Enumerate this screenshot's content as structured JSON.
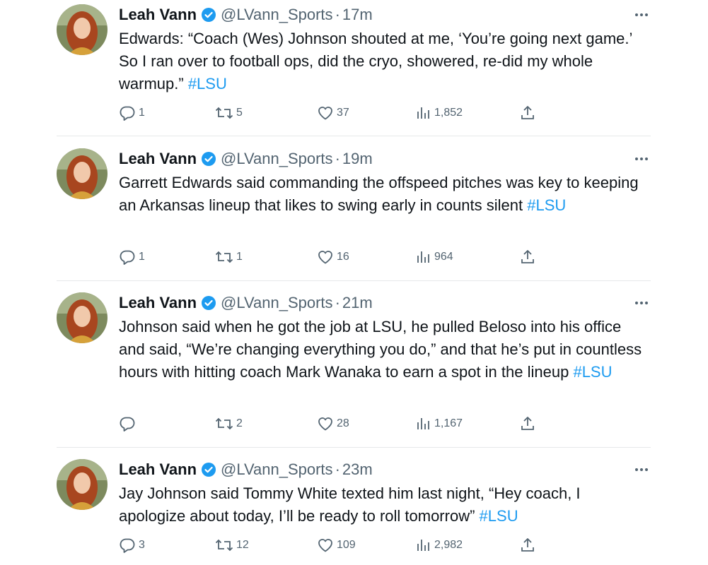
{
  "colors": {
    "text": "#0f1419",
    "secondary": "#536471",
    "link": "#1d9bf0",
    "verified": "#1d9bf0",
    "divider": "#e6e8ea"
  },
  "tweets": [
    {
      "name": "Leah Vann",
      "handle": "@LVann_Sports",
      "separator": "·",
      "time": "17m",
      "text": "Edwards: “Coach (Wes) Johnson shouted at me, ‘You’re going next game.’ So I ran over to football ops, did the cryo, showered, re-did my whole warmup.”",
      "hashtag": "#LSU",
      "replies": "1",
      "retweets": "5",
      "likes": "37",
      "views": "1,852"
    },
    {
      "name": "Leah Vann",
      "handle": "@LVann_Sports",
      "separator": "·",
      "time": "19m",
      "text": "Garrett Edwards said commanding the offspeed pitches was key to keeping an Arkansas lineup that likes to swing early in counts silent",
      "hashtag": "#LSU",
      "replies": "1",
      "retweets": "1",
      "likes": "16",
      "views": "964"
    },
    {
      "name": "Leah Vann",
      "handle": "@LVann_Sports",
      "separator": "·",
      "time": "21m",
      "text": "Johnson said when he got the job at LSU, he pulled Beloso into his office and said, “We’re changing everything you do,” and that he’s put in countless hours with hitting coach Mark Wanaka to earn a spot in the lineup",
      "hashtag": "#LSU",
      "replies": "",
      "retweets": "2",
      "likes": "28",
      "views": "1,167"
    },
    {
      "name": "Leah Vann",
      "handle": "@LVann_Sports",
      "separator": "·",
      "time": "23m",
      "text": "Jay Johnson said Tommy White texted him last night, “Hey coach, I apologize about today, I’ll be ready to roll tomorrow”",
      "hashtag": "#LSU",
      "replies": "3",
      "retweets": "12",
      "likes": "109",
      "views": "2,982"
    }
  ],
  "icons": {
    "reply": "reply-icon",
    "retweet": "retweet-icon",
    "like": "heart-icon",
    "views": "views-chart-icon",
    "share": "share-icon",
    "more": "more-dots-icon",
    "verified": "verified-badge-icon"
  }
}
